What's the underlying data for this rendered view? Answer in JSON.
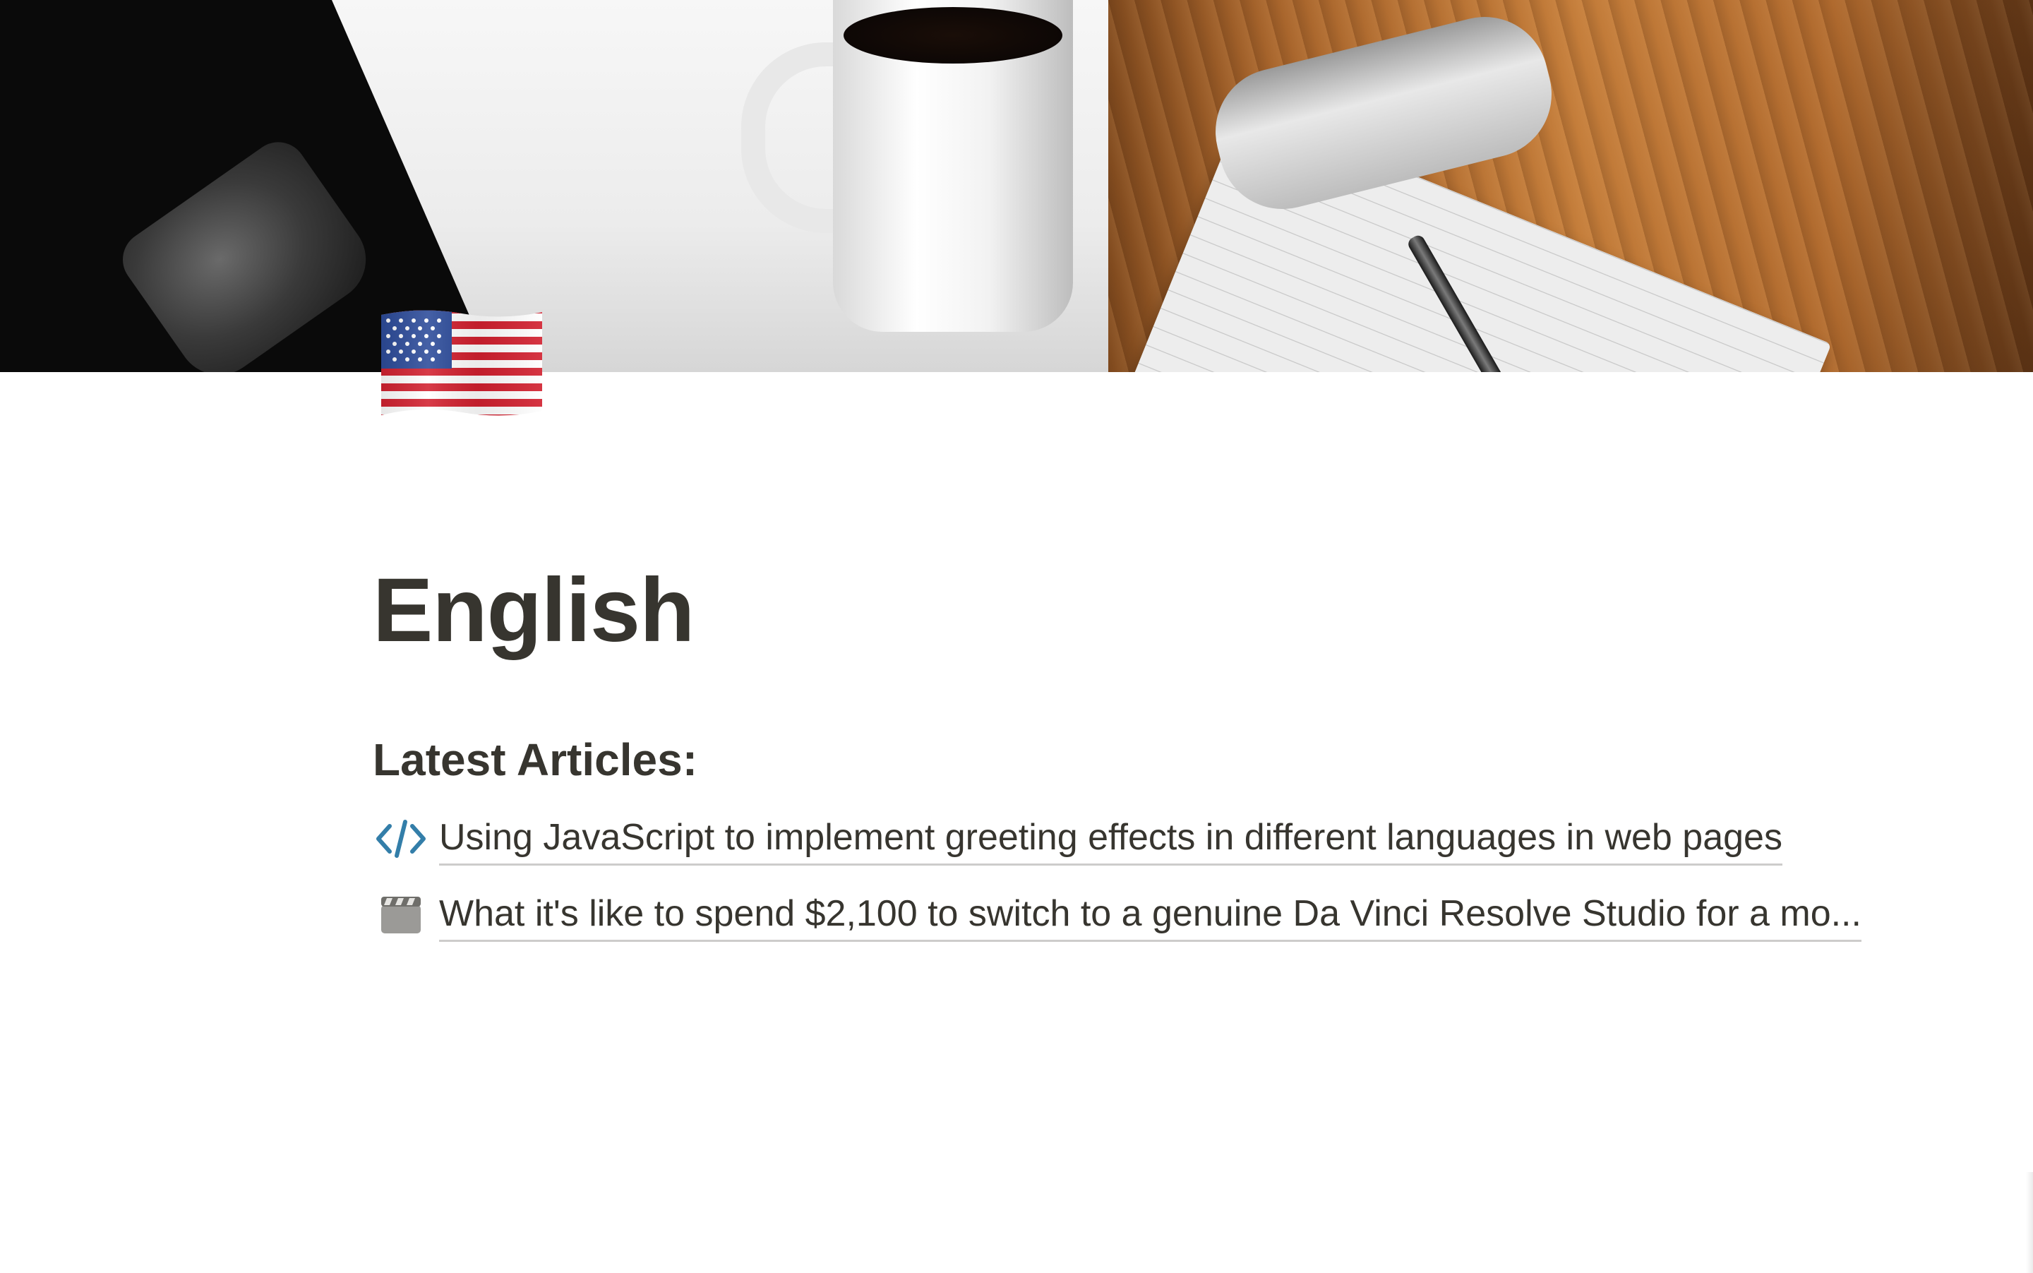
{
  "cover": {
    "description_icon": "cover-photo-coffee-notepad"
  },
  "page_icon": {
    "icon": "us-flag-icon"
  },
  "page": {
    "title": "English"
  },
  "section": {
    "heading": "Latest Articles:"
  },
  "articles": [
    {
      "icon": "code-icon",
      "icon_color": "#337ea9",
      "title": "Using JavaScript to implement greeting effects in different languages in web pages"
    },
    {
      "icon": "clapper-board-icon",
      "title": "What it's like to spend $2,100 to switch to a genuine Da Vinci Resolve Studio for a mo..."
    }
  ],
  "colors": {
    "text": "#37352f",
    "link_underline": "rgba(55,53,47,0.25)",
    "background": "#ffffff"
  }
}
